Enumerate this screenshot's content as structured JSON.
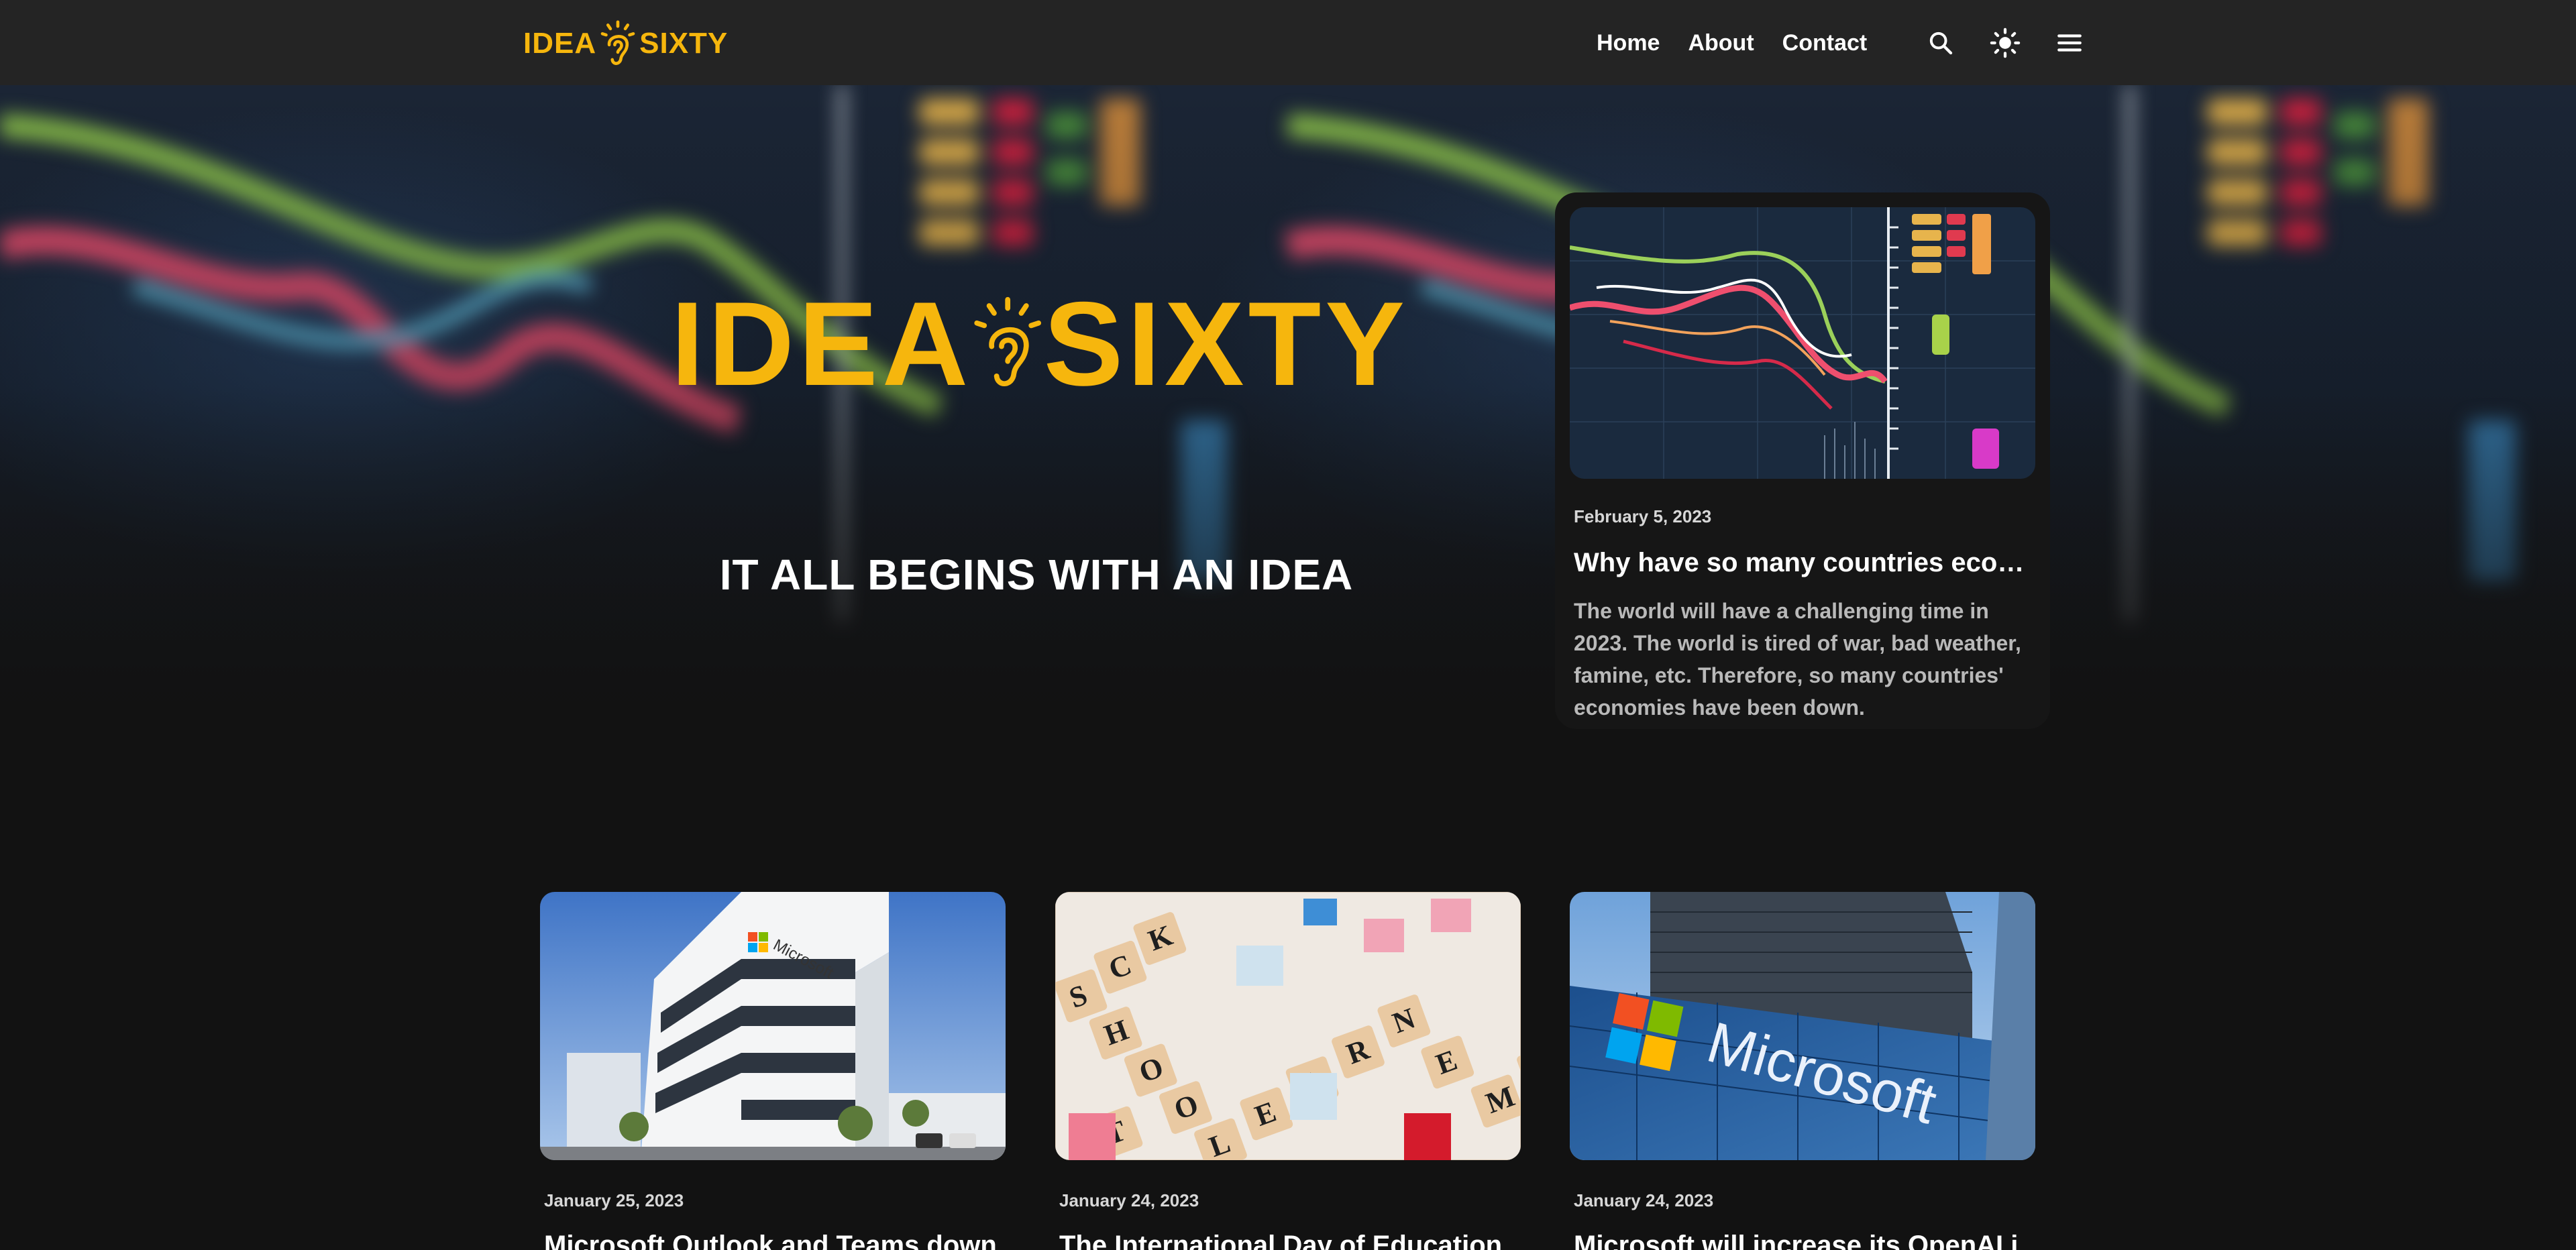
{
  "brand": {
    "name_left": "IDEA",
    "name_right": "SIXTY",
    "accent": "#f6b60d"
  },
  "nav": {
    "links": [
      "Home",
      "About",
      "Contact"
    ],
    "icons": [
      "search-icon",
      "sun-icon",
      "menu-icon"
    ]
  },
  "hero": {
    "tagline": "IT ALL BEGINS WITH AN IDEA"
  },
  "featured": {
    "date": "February 5, 2023",
    "title": "Why have so many countries econo…",
    "description": "The world will have a challenging time in 2023. The world is tired of war, bad weather, famine, etc. Therefore, so many countries' economies have been down."
  },
  "posts": [
    {
      "date": "January 25, 2023",
      "title": "Microsoft Outlook and Teams down"
    },
    {
      "date": "January 24, 2023",
      "title": "The International Day of Education"
    },
    {
      "date": "January 24, 2023",
      "title": "Microsoft will increase its OpenAI i"
    }
  ]
}
